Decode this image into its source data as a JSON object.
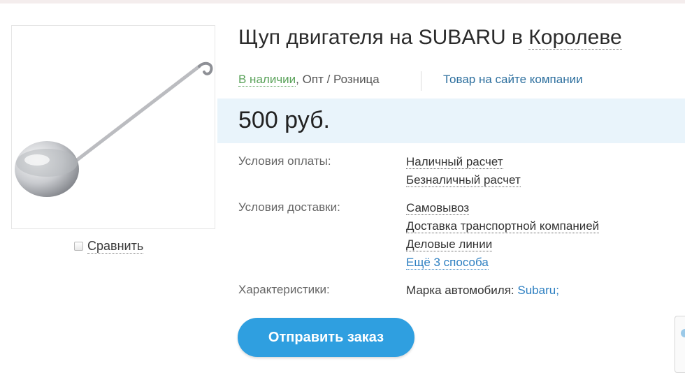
{
  "product": {
    "title": "Щуп двигателя на SUBARU в",
    "city": "Королеве",
    "image_icon": "ladle-image"
  },
  "compare": {
    "label": "Сравнить"
  },
  "availability": {
    "in_stock": "В наличии",
    "separator": ",",
    "wholesale_retail": "Опт / Розница",
    "company_site_link": "Товар на сайте компании"
  },
  "price": "500 руб.",
  "details": {
    "payment_label": "Условия оплаты:",
    "payment_options": [
      "Наличный расчет",
      "Безналичный расчет"
    ],
    "delivery_label": "Условия доставки:",
    "delivery_options": [
      "Самовывоз",
      "Доставка транспортной компанией",
      "Деловые линии"
    ],
    "delivery_more": "Ещё 3 способа",
    "specs_label": "Характеристики:",
    "spec_key": "Марка автомобиля:",
    "spec_value": "Subaru",
    "spec_suffix": ";"
  },
  "order_button": "Отправить заказ",
  "colors": {
    "accent": "#2f9fe0",
    "price_band": "#e9f4fb",
    "in_stock": "#5aa25a",
    "link": "#2d7fc1"
  }
}
